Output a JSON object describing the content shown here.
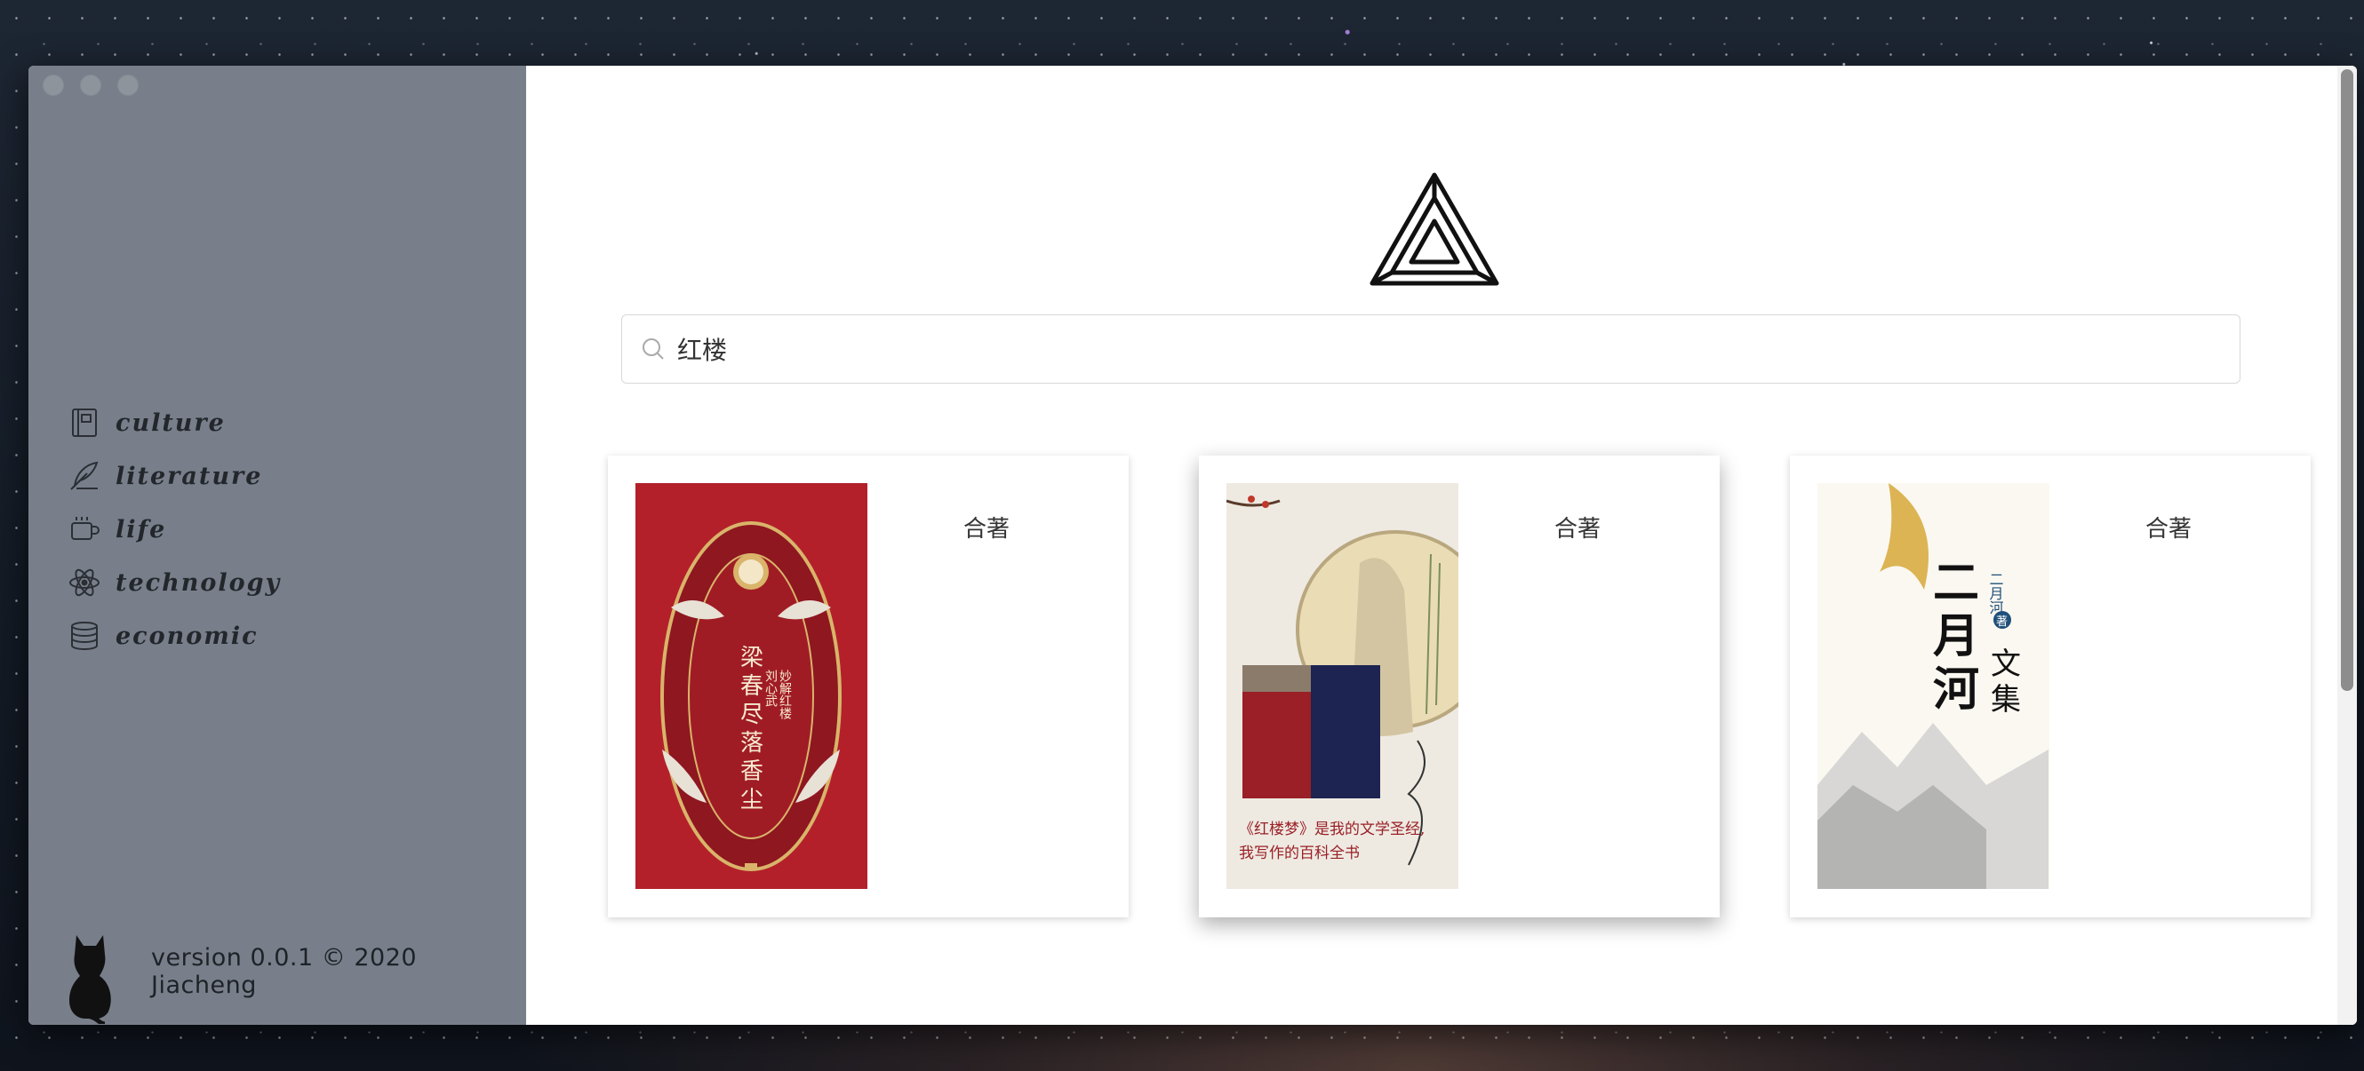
{
  "sidebar": {
    "items": [
      {
        "label": "culture",
        "icon": "book-icon"
      },
      {
        "label": "literature",
        "icon": "feather-icon"
      },
      {
        "label": "life",
        "icon": "coffee-cup-icon"
      },
      {
        "label": "technology",
        "icon": "atom-icon"
      },
      {
        "label": "economic",
        "icon": "coin-stack-icon"
      }
    ],
    "version": "version 0.0.1 © 2020 Jiacheng"
  },
  "search": {
    "value": "红楼"
  },
  "results": [
    {
      "label": "合著",
      "cover_text": [
        "梁",
        "春",
        "尽",
        "落",
        "香",
        "尘",
        "刘心武",
        "妙解红楼"
      ]
    },
    {
      "label": "合著",
      "cover_text": [
        "《红楼梦》是我的文学圣经,",
        "我写作的百科全书"
      ]
    },
    {
      "label": "合著",
      "cover_text": [
        "二",
        "月",
        "河",
        "文",
        "集",
        "二月河",
        "著"
      ]
    }
  ],
  "colors": {
    "sidebar": "#787f8a",
    "accent_red": "#b3202a"
  }
}
